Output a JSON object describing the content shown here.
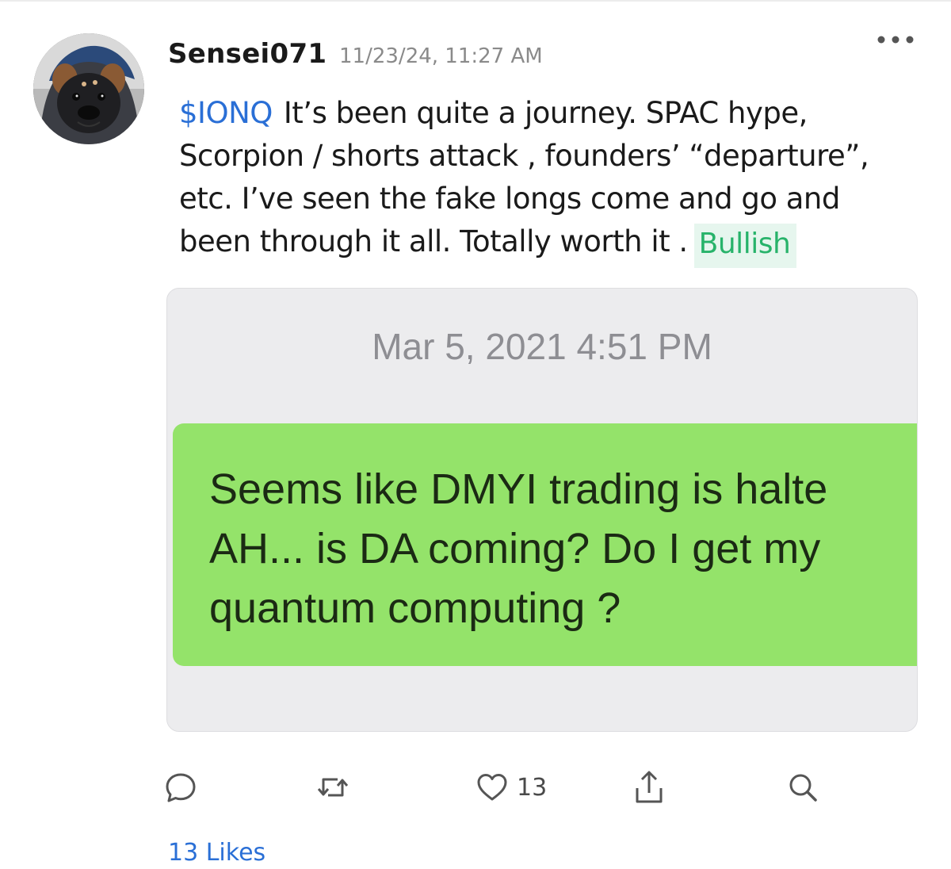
{
  "post": {
    "username": "Sensei071",
    "timestamp": "11/23/24, 11:27 AM",
    "ticker": "$IONQ",
    "lines": [
      "It’s been quite a journey. SPAC hype,",
      "Scorpion / shorts attack , founders’ “departure”,",
      "etc.  I’ve seen the fake longs come and go and",
      "been through it all. Totally worth it ."
    ],
    "sentiment": "Bullish",
    "sentiment_color": "#27b36a",
    "ticker_color": "#2a6fd6"
  },
  "attachment": {
    "date": "Mar 5, 2021 4:51 PM",
    "message_lines": [
      "Seems like DMYI trading is halte",
      "AH... is DA coming? Do I get my",
      "quantum computing ?"
    ],
    "bubble_color": "#94e36a"
  },
  "actions": {
    "reply_icon": "reply-bubble-icon",
    "repost_icon": "repost-icon",
    "like_icon": "heart-icon",
    "like_count": "13",
    "share_icon": "share-icon",
    "search_icon": "search-icon"
  },
  "footer": {
    "likes_summary": "13 Likes"
  }
}
